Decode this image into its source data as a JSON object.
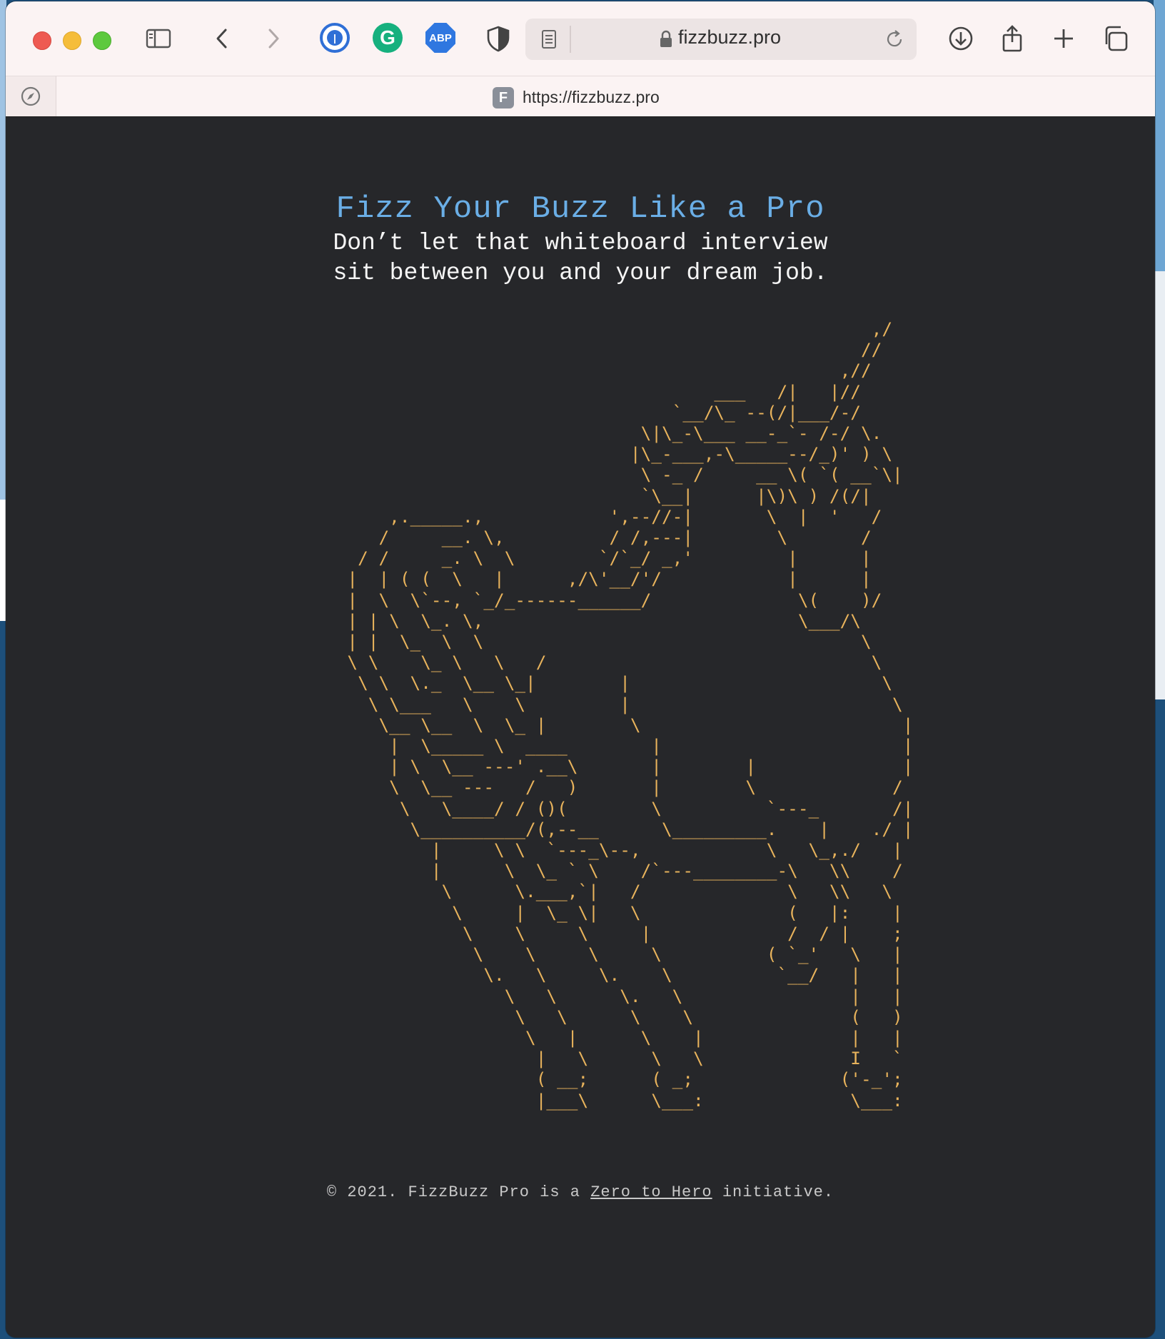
{
  "browser": {
    "url_host": "fizzbuzz.pro",
    "tab_url": "https://fizzbuzz.pro",
    "favicon_letter": "F",
    "extensions": [
      "1password-icon",
      "grammarly-icon",
      "adblock-plus-icon",
      "privacy-shield-icon"
    ],
    "abp_label": "ABP",
    "grammarly_label": "G"
  },
  "page": {
    "title": "Fizz Your Buzz Like a Pro",
    "tagline_line1": "Don’t let that whiteboard interview",
    "tagline_line2": "sit between you and your dream job.",
    "ascii_art": "                                                       ,/\n                                                      //\n                                                    ,//\n                                        ___   /|   |//\n                                    `__/\\_ --(/|___/-/\n                                 \\|\\_-\\___ __-_`- /-/ \\.\n                                |\\_-___,-\\_____--/_)' ) \\\n                                 \\ -_ /     __ \\( `( __`\\|\n                                 `\\__|      |\\)\\ ) /(/|\n         ,._____.,            ',--//-|       \\  |  '   /\n        /     __. \\,          / /,---|        \\       /\n      / /     _. \\  \\        `/`_/ _,'         |      |\n     |  | ( (  \\   |      ,/\\'__/'/            |      |\n     |  \\  \\`--, `_/_------______/              \\(    )/\n     | | \\  \\_. \\,                              \\___/\\\n     | |  \\_  \\  \\                                    \\\n     \\ \\    \\_ \\   \\   /                               \\\n      \\ \\  \\._  \\__ \\_|        |                        \\\n       \\ \\___   \\    \\         |                         \\\n        \\__ \\__  \\  \\_ |        \\                         |\n         |  \\_____ \\  ____        |                       |\n         | \\  \\__ ---' .__\\       |        |              |\n         \\  \\__ ---   /   )       |        \\             /\n          \\   \\____/ / ()(        \\          `---_       /|\n           \\__________/(,--__      \\_________.    |    ./ |\n             |     \\ \\  `---_\\--,            \\   \\_,./   |\n             |      \\  \\_ ` \\    /`---________-\\   \\\\    /\n              \\      \\.___,`|   /              \\   \\\\   \\\n               \\     |  \\_ \\|   \\              (   |:    |\n                \\    \\     \\     |             /  / |    ;\n                 \\    \\     \\     \\          ( `_'   \\   |\n                  \\.   \\     \\.    \\          `__/   |   |\n                    \\   \\      \\.   \\                |   |\n                     \\   \\      \\    \\               (   )\n                      \\   |      \\    |              |   |\n                       |   \\      \\   \\              I   `\n                       ( __;      ( _;              ('-_';\n                       |___\\      \\___:              \\___:",
    "footer_prefix": "© 2021. FizzBuzz Pro is a",
    "footer_link": "Zero to Hero",
    "footer_suffix": "initiative."
  },
  "colors": {
    "page_background": "#26272a",
    "title": "#6aaee6",
    "art": "#e8b35c",
    "toolbar": "#fbf3f3"
  }
}
